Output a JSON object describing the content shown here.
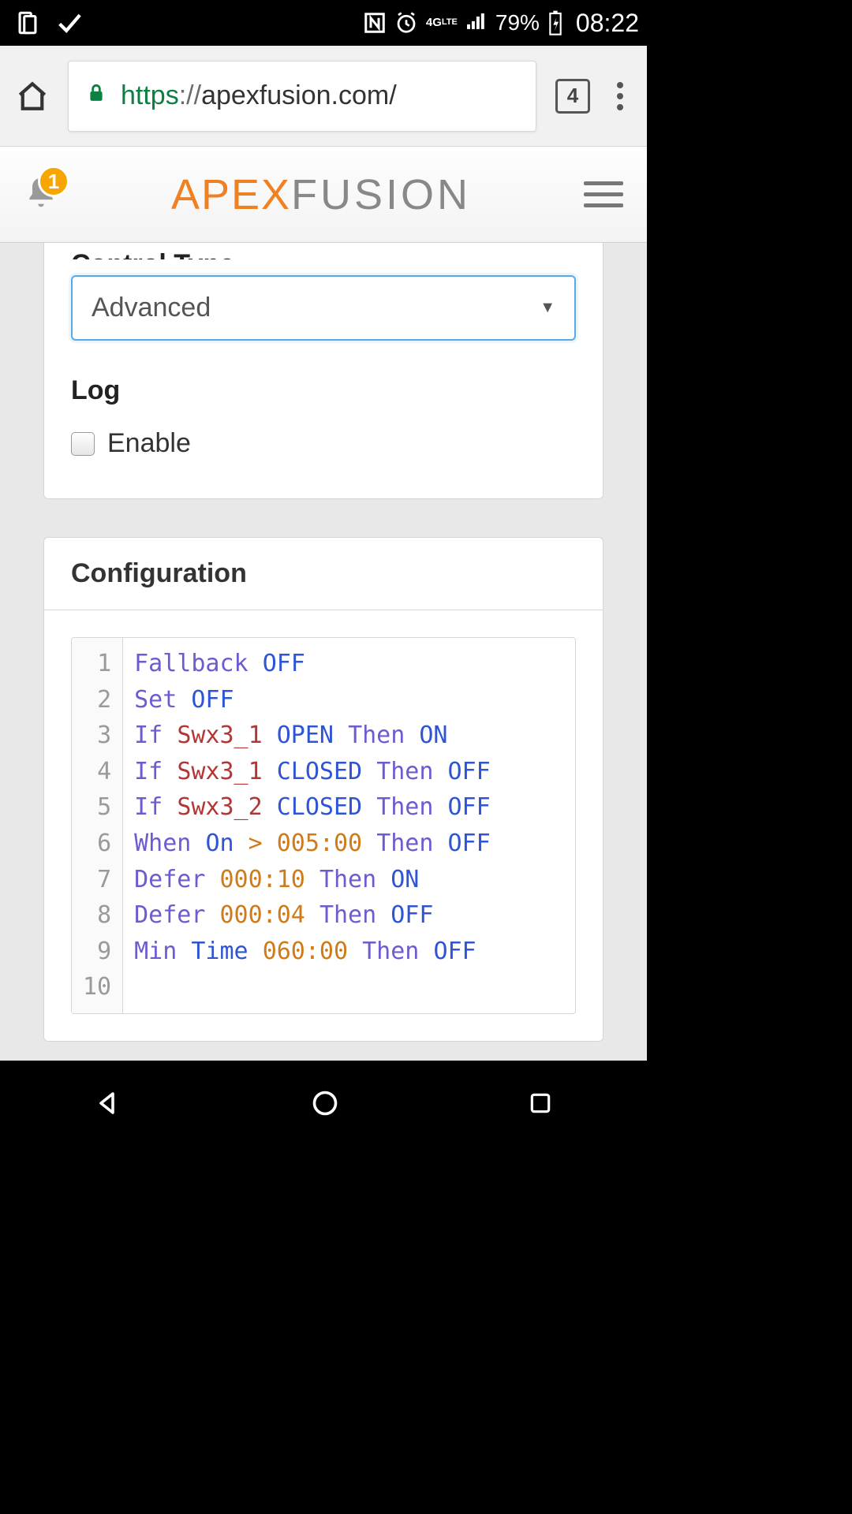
{
  "statusbar": {
    "time": "08:22",
    "battery_pct": "79%",
    "battery_charging": true,
    "net_label": "4G LTE"
  },
  "browser": {
    "url_scheme": "https",
    "url_sep": "://",
    "url_host": "apexfusion.com/",
    "tab_count": "4"
  },
  "header": {
    "notif_count": "1",
    "logo_main": "APEX",
    "logo_sub": "FUSION"
  },
  "form": {
    "control_type_label_partial": "Control Type",
    "control_type_value": "Advanced",
    "log_label": "Log",
    "enable_label": "Enable",
    "enable_checked": false
  },
  "config": {
    "header": "Configuration",
    "lines": [
      {
        "n": 1,
        "tokens": [
          [
            "kw",
            "Fallback"
          ],
          [
            "sp",
            " "
          ],
          [
            "st",
            "OFF"
          ]
        ]
      },
      {
        "n": 2,
        "tokens": [
          [
            "kw",
            "Set"
          ],
          [
            "sp",
            " "
          ],
          [
            "st",
            "OFF"
          ]
        ]
      },
      {
        "n": 3,
        "tokens": [
          [
            "kw",
            "If"
          ],
          [
            "sp",
            " "
          ],
          [
            "id",
            "Swx3_1"
          ],
          [
            "sp",
            " "
          ],
          [
            "st",
            "OPEN"
          ],
          [
            "sp",
            " "
          ],
          [
            "kw",
            "Then"
          ],
          [
            "sp",
            " "
          ],
          [
            "st",
            "ON"
          ]
        ]
      },
      {
        "n": 4,
        "tokens": [
          [
            "kw",
            "If"
          ],
          [
            "sp",
            " "
          ],
          [
            "id",
            "Swx3_1"
          ],
          [
            "sp",
            " "
          ],
          [
            "st",
            "CLOSED"
          ],
          [
            "sp",
            " "
          ],
          [
            "kw",
            "Then"
          ],
          [
            "sp",
            " "
          ],
          [
            "st",
            "OFF"
          ]
        ]
      },
      {
        "n": 5,
        "tokens": [
          [
            "kw",
            "If"
          ],
          [
            "sp",
            " "
          ],
          [
            "id",
            "Swx3_2"
          ],
          [
            "sp",
            " "
          ],
          [
            "st",
            "CLOSED"
          ],
          [
            "sp",
            " "
          ],
          [
            "kw",
            "Then"
          ],
          [
            "sp",
            " "
          ],
          [
            "st",
            "OFF"
          ]
        ]
      },
      {
        "n": 6,
        "tokens": [
          [
            "kw",
            "When"
          ],
          [
            "sp",
            " "
          ],
          [
            "st",
            "On"
          ],
          [
            "sp",
            " "
          ],
          [
            "op",
            ">"
          ],
          [
            "sp",
            " "
          ],
          [
            "num",
            "005:00"
          ],
          [
            "sp",
            " "
          ],
          [
            "kw",
            "Then"
          ],
          [
            "sp",
            " "
          ],
          [
            "st",
            "OFF"
          ]
        ]
      },
      {
        "n": 7,
        "tokens": [
          [
            "kw",
            "Defer"
          ],
          [
            "sp",
            " "
          ],
          [
            "num",
            "000:10"
          ],
          [
            "sp",
            " "
          ],
          [
            "kw",
            "Then"
          ],
          [
            "sp",
            " "
          ],
          [
            "st",
            "ON"
          ]
        ]
      },
      {
        "n": 8,
        "tokens": [
          [
            "kw",
            "Defer"
          ],
          [
            "sp",
            " "
          ],
          [
            "num",
            "000:04"
          ],
          [
            "sp",
            " "
          ],
          [
            "kw",
            "Then"
          ],
          [
            "sp",
            " "
          ],
          [
            "st",
            "OFF"
          ]
        ]
      },
      {
        "n": 9,
        "tokens": [
          [
            "kw",
            "Min"
          ],
          [
            "sp",
            " "
          ],
          [
            "st",
            "Time"
          ],
          [
            "sp",
            " "
          ],
          [
            "num",
            "060:00"
          ],
          [
            "sp",
            " "
          ],
          [
            "kw",
            "Then"
          ],
          [
            "sp",
            " "
          ],
          [
            "st",
            "OFF"
          ]
        ]
      },
      {
        "n": 10,
        "tokens": []
      }
    ]
  }
}
